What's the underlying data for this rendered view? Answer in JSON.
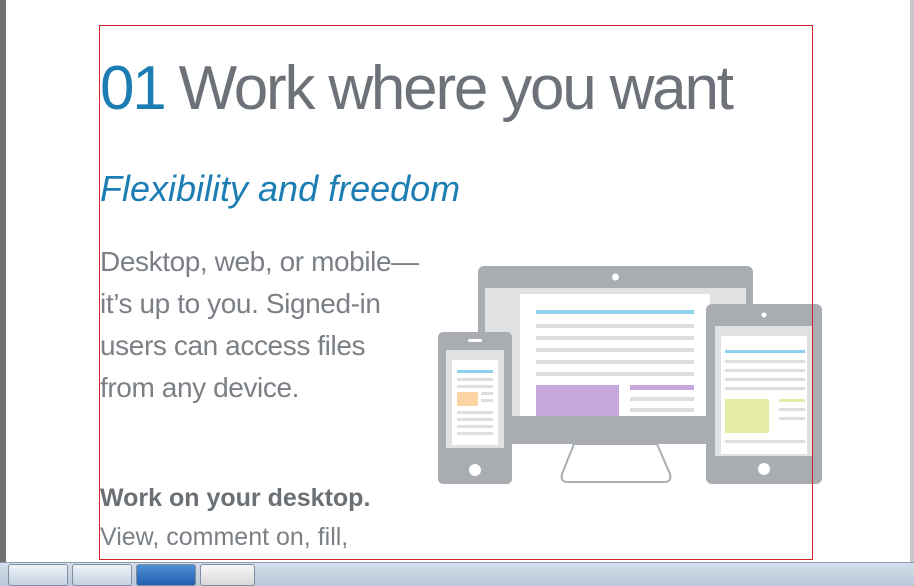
{
  "document": {
    "heading_number": "01",
    "heading_text": "Work where you want",
    "subheading": "Flexibility and freedom",
    "body": "Desktop, web, or mobile—it’s up to you. Signed-in users can access files from any device.",
    "desktop_title": "Work on your desktop.",
    "desktop_text": "View, comment on, fill,"
  },
  "illustration": {
    "icon": "devices-illustration",
    "colors": {
      "frame": "#a9adb2",
      "frame_dark": "#9da2a7",
      "screen_bg": "#dfe1e3",
      "page": "#ffffff",
      "line": "#dcdee0",
      "blue": "#8dd1ef",
      "purple": "#c6a8dc",
      "orange": "#fcd4a3",
      "green": "#e4eba6"
    }
  },
  "colors": {
    "accent_blue": "#1c7db3",
    "text_gray": "#6d7278",
    "selection_red": "#d2232a"
  }
}
